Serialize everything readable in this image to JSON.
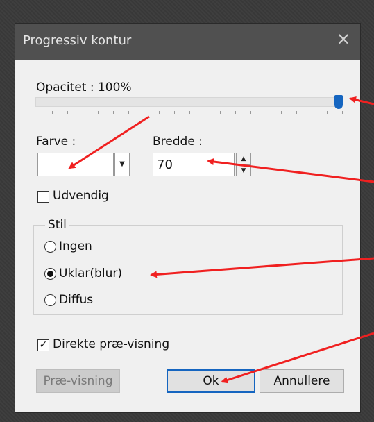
{
  "dialog": {
    "title": "Progressiv kontur",
    "close_glyph": "✕",
    "opacity_label": "Opacitet : 100%",
    "opacity_value": 100,
    "color_label": "Farve :",
    "color_dropdown_glyph": "▼",
    "width_label": "Bredde :",
    "width_value": "70",
    "spin_up": "▲",
    "spin_down": "▼",
    "outer_label": "Udvendig",
    "outer_checked": false,
    "style_group": {
      "title": "Stil",
      "options": [
        "Ingen",
        "Uklar(blur)",
        "Diffus"
      ],
      "selected": "Uklar(blur)"
    },
    "direct_preview_label": "Direkte præ-visning",
    "direct_preview_checked": true,
    "check_glyph": "✓",
    "buttons": {
      "preview": "Præ-visning",
      "ok": "Ok",
      "cancel": "Annullere"
    }
  },
  "colors": {
    "accent": "#1565c0",
    "titlebar": "#505050",
    "annotation_arrow": "#f02020"
  },
  "annotations": [
    "red-arrow-opacity",
    "red-arrow-color",
    "red-arrow-width",
    "red-arrow-blur",
    "red-arrow-ok"
  ]
}
